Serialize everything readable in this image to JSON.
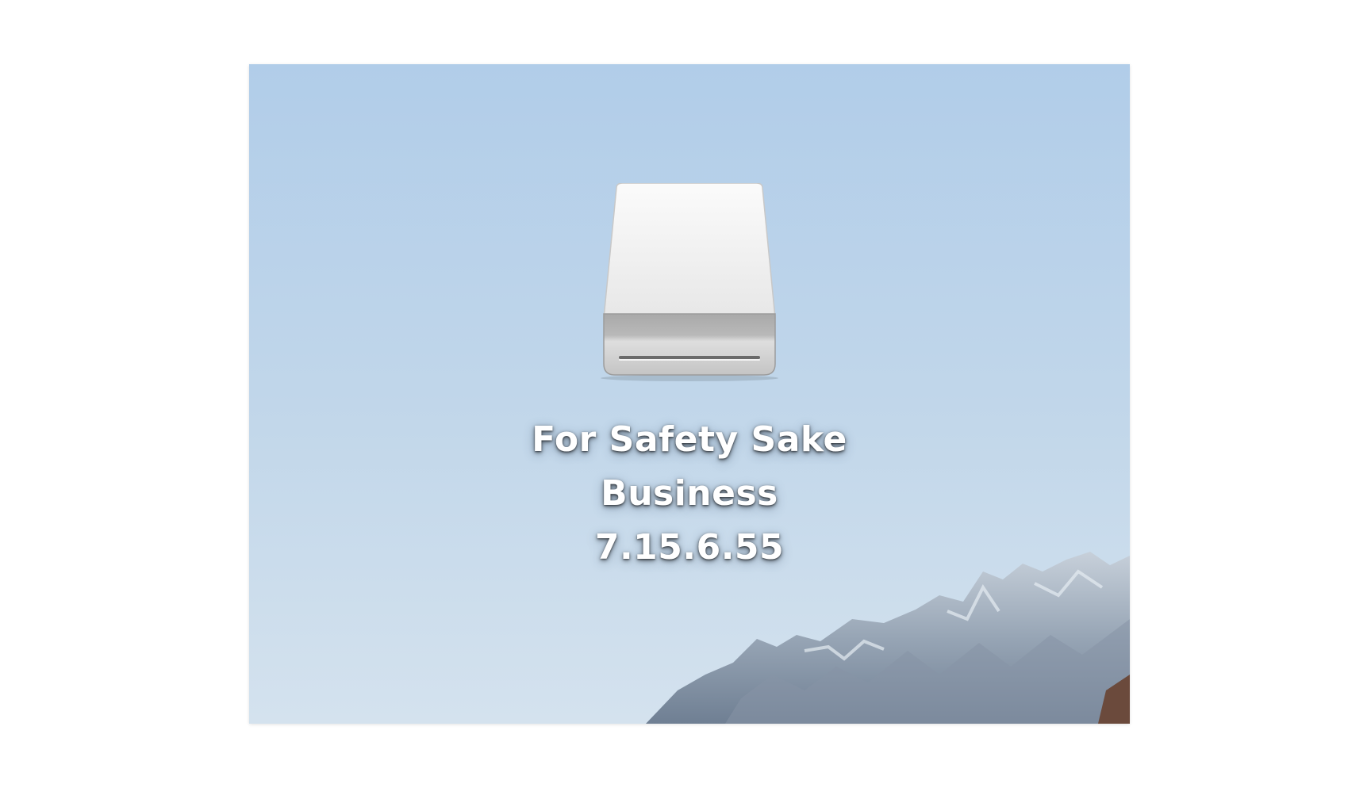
{
  "desktop": {
    "disk": {
      "icon": "external-drive-icon",
      "label_line1": "For Safety Sake",
      "label_line2": "Business 7.15.6.55"
    }
  },
  "colors": {
    "sky_top": "#b3d0ea",
    "sky_bottom": "#d2e1ee",
    "mountain": "#9aa8b8",
    "label_text": "#ffffff"
  }
}
